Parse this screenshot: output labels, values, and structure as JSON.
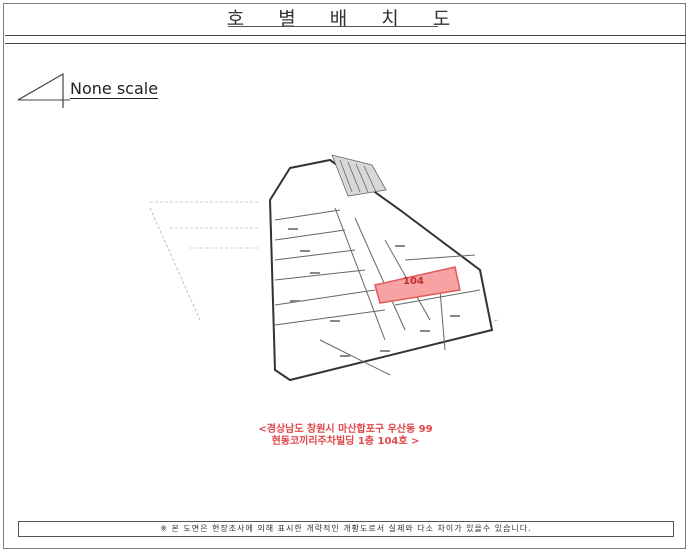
{
  "document": {
    "title": "호 별 배 치 도",
    "scale_label": "None scale",
    "unit_label": "104",
    "address_line1": "<경상남도 창원시 마산합포구 우산동 99",
    "address_line2": "현동코끼리주차빌딩 1층 104호 >",
    "footer_note": "※ 본 도면은 현장조사에 의해 표시한 개략적인 개황도로서 실제와 다소 차이가 있을수 있습니다."
  },
  "colors": {
    "highlight_fill": "#f7a3a3",
    "highlight_stroke": "#e05a5a",
    "address_text": "#e0464a"
  }
}
